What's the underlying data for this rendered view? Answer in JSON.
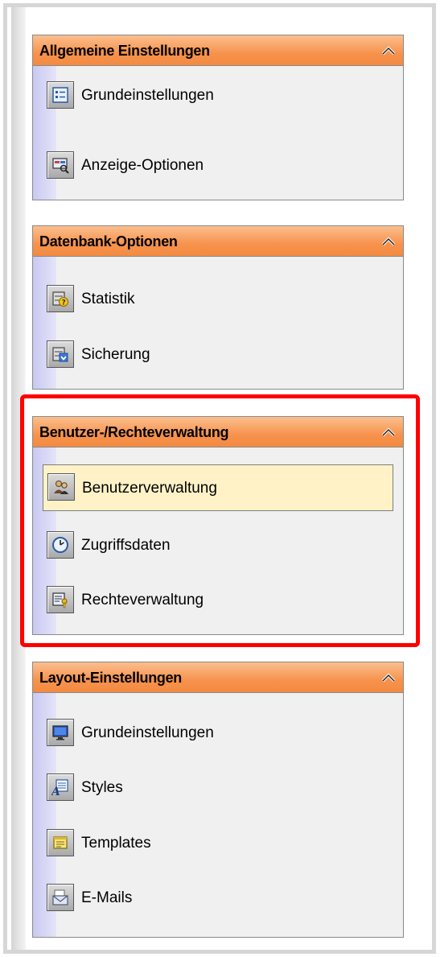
{
  "sections": [
    {
      "title": "Allgemeine Einstellungen",
      "items": [
        {
          "label": "Grundeinstellungen",
          "icon": "settings-list-icon"
        },
        {
          "label": "Anzeige-Optionen",
          "icon": "display-magnifier-icon"
        }
      ]
    },
    {
      "title": "Datenbank-Optionen",
      "items": [
        {
          "label": "Statistik",
          "icon": "database-question-icon"
        },
        {
          "label": "Sicherung",
          "icon": "database-download-icon"
        }
      ]
    },
    {
      "title": "Benutzer-/Rechteverwaltung",
      "highlighted": true,
      "items": [
        {
          "label": "Benutzerverwaltung",
          "icon": "users-icon",
          "active": true
        },
        {
          "label": "Zugriffsdaten",
          "icon": "clock-icon"
        },
        {
          "label": "Rechteverwaltung",
          "icon": "rights-key-icon"
        }
      ]
    },
    {
      "title": "Layout-Einstellungen",
      "items": [
        {
          "label": "Grundeinstellungen",
          "icon": "monitor-icon"
        },
        {
          "label": "Styles",
          "icon": "text-style-icon"
        },
        {
          "label": "Templates",
          "icon": "template-icon"
        },
        {
          "label": "E-Mails",
          "icon": "email-icon"
        }
      ]
    }
  ],
  "colors": {
    "header_orange": "#f7924d",
    "active_item_bg": "#fff2c7",
    "highlight_red": "#ff0000",
    "panel_bg": "#f0f0f0"
  }
}
